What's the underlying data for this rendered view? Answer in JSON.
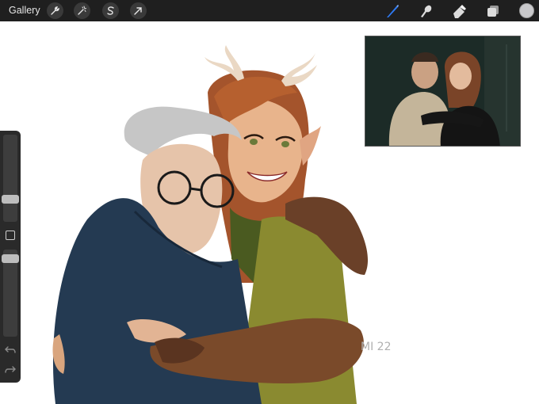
{
  "toolbar": {
    "gallery_label": "Gallery",
    "left_tools": [
      "wrench-icon",
      "magic-wand-icon",
      "selection-icon",
      "transform-arrow-icon"
    ],
    "right_tools": [
      "brush-icon",
      "smudge-icon",
      "eraser-icon",
      "layers-icon"
    ],
    "current_color": "#c9c9cb",
    "active_tool_color": "#2f7bf5"
  },
  "sidebar": {
    "brush_size_level": 0.55,
    "opacity_level": 0.3,
    "icons": [
      "modify-square-icon",
      "undo-icon",
      "redo-icon"
    ]
  },
  "canvas": {
    "signature": "MI 22"
  }
}
